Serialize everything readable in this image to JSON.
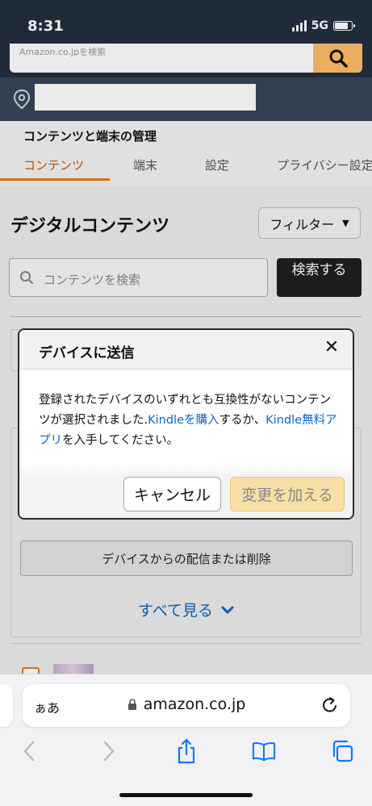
{
  "status_bar": {
    "time": "8:31",
    "network": "5G"
  },
  "amazon_header": {
    "search_placeholder": "Amazon.co.jpを検索",
    "search_icon": "search-icon",
    "location_icon": "location-pin-icon"
  },
  "subnav": {
    "title": "コンテンツと端末の管理",
    "tabs": [
      {
        "label": "コンテンツ",
        "active": true
      },
      {
        "label": "端末",
        "active": false
      },
      {
        "label": "設定",
        "active": false
      },
      {
        "label": "プライバシー設定",
        "active": false
      }
    ]
  },
  "content": {
    "section_title": "デジタルコンテンツ",
    "filter_label": "フィルター",
    "search_placeholder": "コンテンツを検索",
    "search_button": "検索する",
    "device_button": "デバイスからの配信または削除",
    "see_all": "すべて見る"
  },
  "modal": {
    "title": "デバイスに送信",
    "body_prefix": "登録されたデバイスのいずれとも互換性がないコンテンツが選択されました.",
    "link_buy": "Kindleを購入",
    "body_middle": "するか、",
    "link_app": "Kindle無料アプリ",
    "body_suffix": "を入手してください。",
    "cancel_label": "キャンセル",
    "apply_label": "変更を加える"
  },
  "safari": {
    "aa_label": "ぁあ",
    "url": "amazon.co.jp",
    "icons": [
      "back-icon",
      "forward-icon",
      "share-icon",
      "bookmarks-icon",
      "tabs-icon"
    ]
  },
  "colors": {
    "header_bg": "#232f3e",
    "accent_orange": "#e47911",
    "link_blue": "#0a66c2",
    "apply_button_bg": "#f7dfa5"
  }
}
